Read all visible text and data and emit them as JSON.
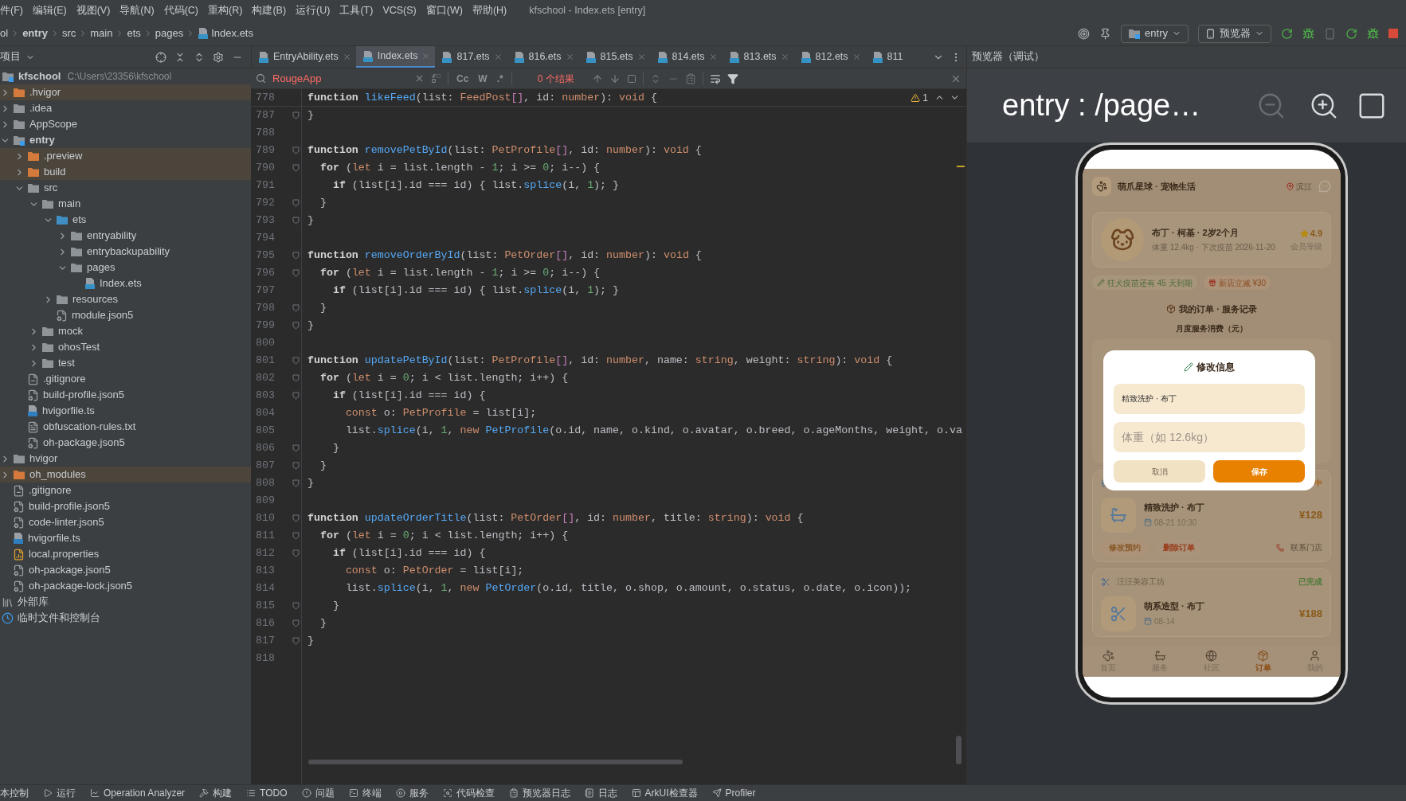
{
  "menu_bar": {
    "items": [
      "件(F)",
      "编辑(E)",
      "视图(V)",
      "导航(N)",
      "代码(C)",
      "重构(R)",
      "构建(B)",
      "运行(U)",
      "工具(T)",
      "VCS(S)",
      "窗口(W)",
      "帮助(H)"
    ],
    "title": "kfschool - Index.ets [entry]"
  },
  "navigation_bar": {
    "breadcrumbs": [
      {
        "label": "ol",
        "kind": "folder"
      },
      {
        "label": "entry",
        "kind": "folder"
      },
      {
        "label": "src",
        "kind": "folder"
      },
      {
        "label": "main",
        "kind": "folder"
      },
      {
        "label": "ets",
        "kind": "folder"
      },
      {
        "label": "pages",
        "kind": "folder"
      },
      {
        "label": "Index.ets",
        "kind": "file"
      }
    ],
    "run_config": "entry",
    "device": "预览器"
  },
  "project_panel": {
    "title": "项目",
    "tree": [
      {
        "label": "kfschool",
        "kind": "module",
        "path": "C:\\Users\\23356\\kfschool",
        "children": [
          {
            "label": ".hvigor",
            "kind": "excluded",
            "expanded": false
          },
          {
            "label": ".idea",
            "kind": "folder",
            "expanded": false
          },
          {
            "label": "AppScope",
            "kind": "folder",
            "expanded": false
          },
          {
            "label": "entry",
            "kind": "module",
            "expanded": true,
            "children": [
              {
                "label": ".preview",
                "kind": "excluded",
                "expanded": false
              },
              {
                "label": "build",
                "kind": "excluded",
                "expanded": false
              },
              {
                "label": "src",
                "kind": "folder",
                "expanded": true,
                "children": [
                  {
                    "label": "main",
                    "kind": "folder",
                    "expanded": true,
                    "children": [
                      {
                        "label": "ets",
                        "kind": "source",
                        "expanded": true,
                        "children": [
                          {
                            "label": "entryability",
                            "kind": "folder",
                            "expanded": false
                          },
                          {
                            "label": "entrybackupability",
                            "kind": "folder",
                            "expanded": false
                          },
                          {
                            "label": "pages",
                            "kind": "folder",
                            "expanded": true,
                            "children": [
                              {
                                "label": "Index.ets",
                                "kind": "ets"
                              }
                            ]
                          }
                        ]
                      },
                      {
                        "label": "resources",
                        "kind": "folder",
                        "expanded": false
                      },
                      {
                        "label": "module.json5",
                        "kind": "json"
                      }
                    ]
                  },
                  {
                    "label": "mock",
                    "kind": "folder",
                    "expanded": false
                  },
                  {
                    "label": "ohosTest",
                    "kind": "folder",
                    "expanded": false
                  },
                  {
                    "label": "test",
                    "kind": "folder",
                    "expanded": false
                  }
                ]
              },
              {
                "label": ".gitignore",
                "kind": "ignore"
              },
              {
                "label": "build-profile.json5",
                "kind": "json"
              },
              {
                "label": "hvigorfile.ts",
                "kind": "ts"
              },
              {
                "label": "obfuscation-rules.txt",
                "kind": "text"
              },
              {
                "label": "oh-package.json5",
                "kind": "json"
              }
            ]
          },
          {
            "label": "hvigor",
            "kind": "folder",
            "expanded": false
          },
          {
            "label": "oh_modules",
            "kind": "excluded",
            "expanded": false
          },
          {
            "label": ".gitignore",
            "kind": "ignore"
          },
          {
            "label": "build-profile.json5",
            "kind": "json"
          },
          {
            "label": "code-linter.json5",
            "kind": "json"
          },
          {
            "label": "hvigorfile.ts",
            "kind": "ts"
          },
          {
            "label": "local.properties",
            "kind": "props"
          },
          {
            "label": "oh-package.json5",
            "kind": "json"
          },
          {
            "label": "oh-package-lock.json5",
            "kind": "json"
          }
        ]
      },
      {
        "label": "外部库",
        "kind": "library"
      },
      {
        "label": "临时文件和控制台",
        "kind": "scratch"
      }
    ]
  },
  "editor": {
    "tabs": [
      {
        "label": "EntryAbility.ets",
        "selected": false,
        "closable": true
      },
      {
        "label": "Index.ets",
        "selected": true,
        "closable": true
      },
      {
        "label": "817.ets",
        "selected": false,
        "closable": true
      },
      {
        "label": "816.ets",
        "selected": false,
        "closable": true
      },
      {
        "label": "815.ets",
        "selected": false,
        "closable": true
      },
      {
        "label": "814.ets",
        "selected": false,
        "closable": true
      },
      {
        "label": "813.ets",
        "selected": false,
        "closable": true
      },
      {
        "label": "812.ets",
        "selected": false,
        "closable": true
      },
      {
        "label": "811",
        "selected": false,
        "closable": false
      }
    ],
    "find": {
      "value": "RougeApp",
      "options": [
        "Cc",
        "W",
        ".*"
      ],
      "results": "0 个结果"
    },
    "warnings": "1",
    "lines": [
      {
        "num": "778",
        "fold": false,
        "tokens": [
          {
            "kind": "k",
            "text": "function "
          },
          {
            "kind": "f",
            "text": "likeFeed"
          },
          {
            "kind": "p",
            "text": "(list: "
          },
          {
            "kind": "m",
            "text": "FeedPost"
          },
          {
            "kind": "b",
            "text": "[]"
          },
          {
            "kind": "p",
            "text": ", id: "
          },
          {
            "kind": "m",
            "text": "number"
          },
          {
            "kind": "p",
            "text": "): "
          },
          {
            "kind": "m",
            "text": "void"
          },
          {
            "kind": "p",
            "text": " {"
          }
        ]
      },
      {
        "num": "787",
        "fold": true,
        "tokens": [
          {
            "kind": "p",
            "text": "}"
          }
        ]
      },
      {
        "num": "788",
        "fold": false
      },
      {
        "num": "789",
        "fold": true,
        "tokens": [
          {
            "kind": "k",
            "text": "function "
          },
          {
            "kind": "f",
            "text": "removePetById"
          },
          {
            "kind": "p",
            "text": "(list: "
          },
          {
            "kind": "m",
            "text": "PetProfile"
          },
          {
            "kind": "b",
            "text": "[]"
          },
          {
            "kind": "p",
            "text": ", id: "
          },
          {
            "kind": "m",
            "text": "number"
          },
          {
            "kind": "p",
            "text": "): "
          },
          {
            "kind": "m",
            "text": "void"
          },
          {
            "kind": "p",
            "text": " {"
          }
        ]
      },
      {
        "num": "790",
        "fold": true,
        "tokens": [
          {
            "kind": "k",
            "text": "  for "
          },
          {
            "kind": "p",
            "text": "("
          },
          {
            "kind": "m",
            "text": "let"
          },
          {
            "kind": "p",
            "text": " i = list.length - "
          },
          {
            "kind": "n",
            "text": "1"
          },
          {
            "kind": "p",
            "text": "; i >= "
          },
          {
            "kind": "n",
            "text": "0"
          },
          {
            "kind": "p",
            "text": "; i--) {"
          }
        ]
      },
      {
        "num": "791",
        "fold": false,
        "tokens": [
          {
            "kind": "k",
            "text": "    if "
          },
          {
            "kind": "p",
            "text": "(list[i].id === id) { list."
          },
          {
            "kind": "f",
            "text": "splice"
          },
          {
            "kind": "p",
            "text": "(i, "
          },
          {
            "kind": "n",
            "text": "1"
          },
          {
            "kind": "p",
            "text": "); }"
          }
        ]
      },
      {
        "num": "792",
        "fold": true,
        "tokens": [
          {
            "kind": "p",
            "text": "  }"
          }
        ]
      },
      {
        "num": "793",
        "fold": true,
        "tokens": [
          {
            "kind": "p",
            "text": "}"
          }
        ]
      },
      {
        "num": "794",
        "fold": false
      },
      {
        "num": "795",
        "fold": true,
        "tokens": [
          {
            "kind": "k",
            "text": "function "
          },
          {
            "kind": "f",
            "text": "removeOrderById"
          },
          {
            "kind": "p",
            "text": "(list: "
          },
          {
            "kind": "m",
            "text": "PetOrder"
          },
          {
            "kind": "b",
            "text": "[]"
          },
          {
            "kind": "p",
            "text": ", id: "
          },
          {
            "kind": "m",
            "text": "number"
          },
          {
            "kind": "p",
            "text": "): "
          },
          {
            "kind": "m",
            "text": "void"
          },
          {
            "kind": "p",
            "text": " {"
          }
        ]
      },
      {
        "num": "796",
        "fold": true,
        "tokens": [
          {
            "kind": "k",
            "text": "  for "
          },
          {
            "kind": "p",
            "text": "("
          },
          {
            "kind": "m",
            "text": "let"
          },
          {
            "kind": "p",
            "text": " i = list.length - "
          },
          {
            "kind": "n",
            "text": "1"
          },
          {
            "kind": "p",
            "text": "; i >= "
          },
          {
            "kind": "n",
            "text": "0"
          },
          {
            "kind": "p",
            "text": "; i--) {"
          }
        ]
      },
      {
        "num": "797",
        "fold": false,
        "tokens": [
          {
            "kind": "k",
            "text": "    if "
          },
          {
            "kind": "p",
            "text": "(list[i].id === id) { list."
          },
          {
            "kind": "f",
            "text": "splice"
          },
          {
            "kind": "p",
            "text": "(i, "
          },
          {
            "kind": "n",
            "text": "1"
          },
          {
            "kind": "p",
            "text": "); }"
          }
        ]
      },
      {
        "num": "798",
        "fold": true,
        "tokens": [
          {
            "kind": "p",
            "text": "  }"
          }
        ]
      },
      {
        "num": "799",
        "fold": true,
        "tokens": [
          {
            "kind": "p",
            "text": "}"
          }
        ]
      },
      {
        "num": "800",
        "fold": false
      },
      {
        "num": "801",
        "fold": true,
        "tokens": [
          {
            "kind": "k",
            "text": "function "
          },
          {
            "kind": "f",
            "text": "updatePetById"
          },
          {
            "kind": "p",
            "text": "(list: "
          },
          {
            "kind": "m",
            "text": "PetProfile"
          },
          {
            "kind": "b",
            "text": "[]"
          },
          {
            "kind": "p",
            "text": ", id: "
          },
          {
            "kind": "m",
            "text": "number"
          },
          {
            "kind": "p",
            "text": ", name: "
          },
          {
            "kind": "m",
            "text": "string"
          },
          {
            "kind": "p",
            "text": ", weight: "
          },
          {
            "kind": "m",
            "text": "string"
          },
          {
            "kind": "p",
            "text": "): "
          },
          {
            "kind": "m",
            "text": "void"
          },
          {
            "kind": "p",
            "text": " {"
          }
        ]
      },
      {
        "num": "802",
        "fold": true,
        "tokens": [
          {
            "kind": "k",
            "text": "  for "
          },
          {
            "kind": "p",
            "text": "("
          },
          {
            "kind": "m",
            "text": "let"
          },
          {
            "kind": "p",
            "text": " i = "
          },
          {
            "kind": "n",
            "text": "0"
          },
          {
            "kind": "p",
            "text": "; i < list.length; i++) {"
          }
        ]
      },
      {
        "num": "803",
        "fold": true,
        "tokens": [
          {
            "kind": "k",
            "text": "    if "
          },
          {
            "kind": "p",
            "text": "(list[i].id === id) {"
          }
        ]
      },
      {
        "num": "804",
        "fold": false,
        "tokens": [
          {
            "kind": "m",
            "text": "      const "
          },
          {
            "kind": "p",
            "text": "o: "
          },
          {
            "kind": "m",
            "text": "PetProfile"
          },
          {
            "kind": "p",
            "text": " = list[i];"
          }
        ]
      },
      {
        "num": "805",
        "fold": false,
        "tokens": [
          {
            "kind": "p",
            "text": "      list."
          },
          {
            "kind": "f",
            "text": "splice"
          },
          {
            "kind": "p",
            "text": "(i, "
          },
          {
            "kind": "n",
            "text": "1"
          },
          {
            "kind": "p",
            "text": ", "
          },
          {
            "kind": "m",
            "text": "new "
          },
          {
            "kind": "f",
            "text": "PetProfile"
          },
          {
            "kind": "p",
            "text": "(o.id, name, o.kind, o.avatar, o.breed, o.ageMonths, weight, o.va"
          }
        ]
      },
      {
        "num": "806",
        "fold": true,
        "tokens": [
          {
            "kind": "p",
            "text": "    }"
          }
        ]
      },
      {
        "num": "807",
        "fold": true,
        "tokens": [
          {
            "kind": "p",
            "text": "  }"
          }
        ]
      },
      {
        "num": "808",
        "fold": true,
        "tokens": [
          {
            "kind": "p",
            "text": "}"
          }
        ]
      },
      {
        "num": "809",
        "fold": false
      },
      {
        "num": "810",
        "fold": true,
        "tokens": [
          {
            "kind": "k",
            "text": "function "
          },
          {
            "kind": "f",
            "text": "updateOrderTitle"
          },
          {
            "kind": "p",
            "text": "(list: "
          },
          {
            "kind": "m",
            "text": "PetOrder"
          },
          {
            "kind": "b",
            "text": "[]"
          },
          {
            "kind": "p",
            "text": ", id: "
          },
          {
            "kind": "m",
            "text": "number"
          },
          {
            "kind": "p",
            "text": ", title: "
          },
          {
            "kind": "m",
            "text": "string"
          },
          {
            "kind": "p",
            "text": "): "
          },
          {
            "kind": "m",
            "text": "void"
          },
          {
            "kind": "p",
            "text": " {"
          }
        ]
      },
      {
        "num": "811",
        "fold": true,
        "tokens": [
          {
            "kind": "k",
            "text": "  for "
          },
          {
            "kind": "p",
            "text": "("
          },
          {
            "kind": "m",
            "text": "let"
          },
          {
            "kind": "p",
            "text": " i = "
          },
          {
            "kind": "n",
            "text": "0"
          },
          {
            "kind": "p",
            "text": "; i < list.length; i++) {"
          }
        ]
      },
      {
        "num": "812",
        "fold": true,
        "tokens": [
          {
            "kind": "k",
            "text": "    if "
          },
          {
            "kind": "p",
            "text": "(list[i].id === id) {"
          }
        ]
      },
      {
        "num": "813",
        "fold": false,
        "tokens": [
          {
            "kind": "m",
            "text": "      const "
          },
          {
            "kind": "p",
            "text": "o: "
          },
          {
            "kind": "m",
            "text": "PetOrder"
          },
          {
            "kind": "p",
            "text": " = list[i];"
          }
        ]
      },
      {
        "num": "814",
        "fold": false,
        "tokens": [
          {
            "kind": "p",
            "text": "      list."
          },
          {
            "kind": "f",
            "text": "splice"
          },
          {
            "kind": "p",
            "text": "(i, "
          },
          {
            "kind": "n",
            "text": "1"
          },
          {
            "kind": "p",
            "text": ", "
          },
          {
            "kind": "m",
            "text": "new "
          },
          {
            "kind": "f",
            "text": "PetOrder"
          },
          {
            "kind": "p",
            "text": "(o.id, title, o.shop, o.amount, o.status, o.date, o.icon));"
          }
        ]
      },
      {
        "num": "815",
        "fold": true,
        "tokens": [
          {
            "kind": "p",
            "text": "    }"
          }
        ]
      },
      {
        "num": "816",
        "fold": true,
        "tokens": [
          {
            "kind": "p",
            "text": "  }"
          }
        ]
      },
      {
        "num": "817",
        "fold": true,
        "tokens": [
          {
            "kind": "p",
            "text": "}"
          }
        ]
      },
      {
        "num": "818",
        "fold": false
      }
    ]
  },
  "preview": {
    "title": "预览器（调试）",
    "page": "entry : /page…",
    "app": {
      "header": {
        "title": "萌爪星球 · 宠物生活",
        "location": "滨江"
      },
      "pet": {
        "name": "布丁 · 柯基 · 2岁2个月",
        "details": "体重 12.4kg · 下次疫苗 2026-11-20",
        "rating": "4.9",
        "rating_label": "会员等级"
      },
      "chips": [
        {
          "text": "狂犬疫苗还有 45 天到期",
          "kind": "vaccine"
        },
        {
          "text": "新店立减 ¥30",
          "kind": "gift"
        }
      ],
      "section_title": "我的订单 · 服务记录",
      "chart_title": "月度服务消费（元）",
      "orders": [
        {
          "kind": "bath",
          "status": {
            "text": "中",
            "color": "#a8641c"
          },
          "title": "精致洗护 · 布丁",
          "date": "08-21 10:30",
          "price": "¥128",
          "actions": [
            "修改预约",
            "删除订单"
          ],
          "contact": "联系门店"
        },
        {
          "kind": "groom",
          "shop": "汪汪美容工坊",
          "status": {
            "text": "已完成",
            "color": "#4f7a3a"
          },
          "title": "萌系造型 · 布丁",
          "date": "08-14",
          "price": "¥188"
        }
      ],
      "nav": [
        {
          "label": "首页",
          "kind": "home",
          "selected": false
        },
        {
          "label": "服务",
          "kind": "service",
          "selected": false
        },
        {
          "label": "社区",
          "kind": "community",
          "selected": false
        },
        {
          "label": "订单",
          "kind": "orders",
          "selected": true
        },
        {
          "label": "我的",
          "kind": "me",
          "selected": false
        }
      ],
      "dialog": {
        "title": "修改信息",
        "fields": [
          {
            "value": "精致洗护 · 布丁"
          },
          {
            "placeholder": "体重（如 12.6kg）"
          }
        ],
        "buttons": [
          {
            "label": "取消",
            "kind": "cancel"
          },
          {
            "label": "保存",
            "kind": "confirm"
          }
        ]
      }
    }
  },
  "tool_windows": [
    {
      "label": "本控制",
      "kind": "vcs"
    },
    {
      "label": "运行",
      "kind": "run"
    },
    {
      "label": "Operation Analyzer",
      "kind": "analyzer"
    },
    {
      "label": "构建",
      "kind": "build"
    },
    {
      "label": "TODO",
      "kind": "todo"
    },
    {
      "label": "问题",
      "kind": "problems"
    },
    {
      "label": "终端",
      "kind": "terminal"
    },
    {
      "label": "服务",
      "kind": "services"
    },
    {
      "label": "代码检查",
      "kind": "inspect"
    },
    {
      "label": "预览器日志",
      "kind": "previewlog"
    },
    {
      "label": "日志",
      "kind": "log"
    },
    {
      "label": "ArkUI检查器",
      "kind": "arkui"
    },
    {
      "label": "Profiler",
      "kind": "profiler"
    }
  ]
}
